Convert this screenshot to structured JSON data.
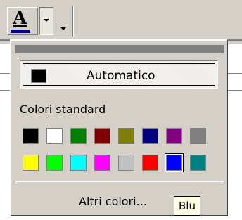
{
  "toolbar": {
    "font_color_icon": "font-color-icon",
    "font_color_glyph": "A",
    "current_color": "#000080",
    "dropdown_icon": "chevron-down-icon",
    "options_icon": "chevron-down-icon"
  },
  "popup": {
    "automatic_label": "Automatico",
    "automatic_color": "#000000",
    "standard_colors_label": "Colori standard",
    "more_colors_label": "Altri colori...",
    "tooltip": "Blu",
    "swatches": [
      [
        "#000000",
        "#ffffff",
        "#008000",
        "#800000",
        "#808000",
        "#000080",
        "#800080",
        "#808080"
      ],
      [
        "#ffff00",
        "#00ff00",
        "#00ffff",
        "#ff00ff",
        "#c0c0c0",
        "#ff0000",
        "#0000ff",
        "#008080"
      ]
    ],
    "selected_swatch": "#0000ff"
  }
}
